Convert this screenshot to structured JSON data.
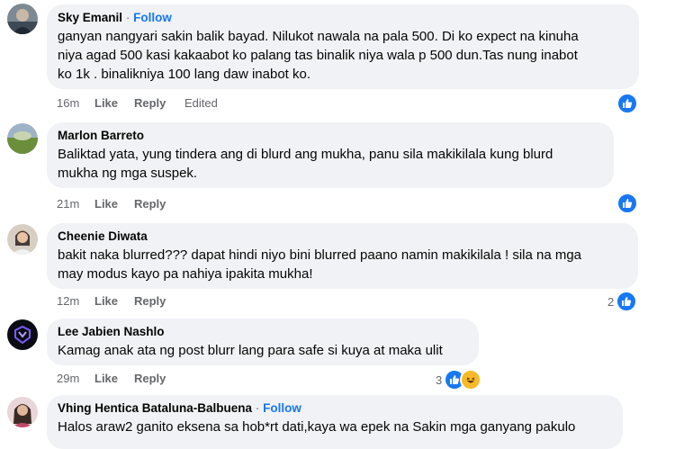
{
  "follow_label": "Follow",
  "separator": "·",
  "action_like": "Like",
  "action_reply": "Reply",
  "colors": {
    "bubble": "#f0f2f5",
    "accent": "#1877f2",
    "meta": "#65676b"
  },
  "comments": [
    {
      "author": "Sky Emanil",
      "show_follow": true,
      "lines": [
        "ganyan nangyari sakin balik bayad. Nilukot nawala na pala 500. Di ko expect na kinuha",
        "niya agad 500 kasi kakaabot ko palang tas binalik niya wala p 500 dun.Tas nung inabot",
        "ko 1k . binalikniya 100 lang daw inabot ko."
      ],
      "time": "16m",
      "edited": "Edited",
      "reactions": {
        "icons": [
          "like-icon"
        ],
        "count": ""
      }
    },
    {
      "author": "Marlon Barreto",
      "show_follow": false,
      "lines": [
        "Baliktad yata, yung tindera ang di blurd ang mukha, panu sila makikilala kung blurd",
        "mukha ng mga suspek."
      ],
      "time": "21m",
      "edited": "",
      "reactions": {
        "icons": [
          "like-icon"
        ],
        "count": ""
      }
    },
    {
      "author": "Cheenie Diwata",
      "show_follow": false,
      "lines": [
        "bakit naka blurred??? dapat hindi niyo bini blurred paano namin makikilala ! sila na mga",
        "may modus kayo pa nahiya ipakita mukha!"
      ],
      "time": "12m",
      "edited": "",
      "reactions": {
        "icons": [
          "like-icon"
        ],
        "count": "2"
      }
    },
    {
      "author": "Lee Jabien Nashlo",
      "show_follow": false,
      "lines": [
        "Kamag anak ata ng post blurr lang para safe si kuya at maka ulit"
      ],
      "time": "29m",
      "edited": "",
      "reactions": {
        "icons": [
          "like-icon",
          "haha-icon"
        ],
        "count": "3"
      }
    },
    {
      "author": "Vhing Hentica Bataluna-Balbuena",
      "show_follow": true,
      "lines": [
        "Halos araw2 ganito eksena sa hob*rt dati,kaya wa epek na Sakin mga ganyang pakulo"
      ],
      "time": "",
      "edited": "",
      "reactions": {
        "icons": [],
        "count": ""
      }
    }
  ]
}
